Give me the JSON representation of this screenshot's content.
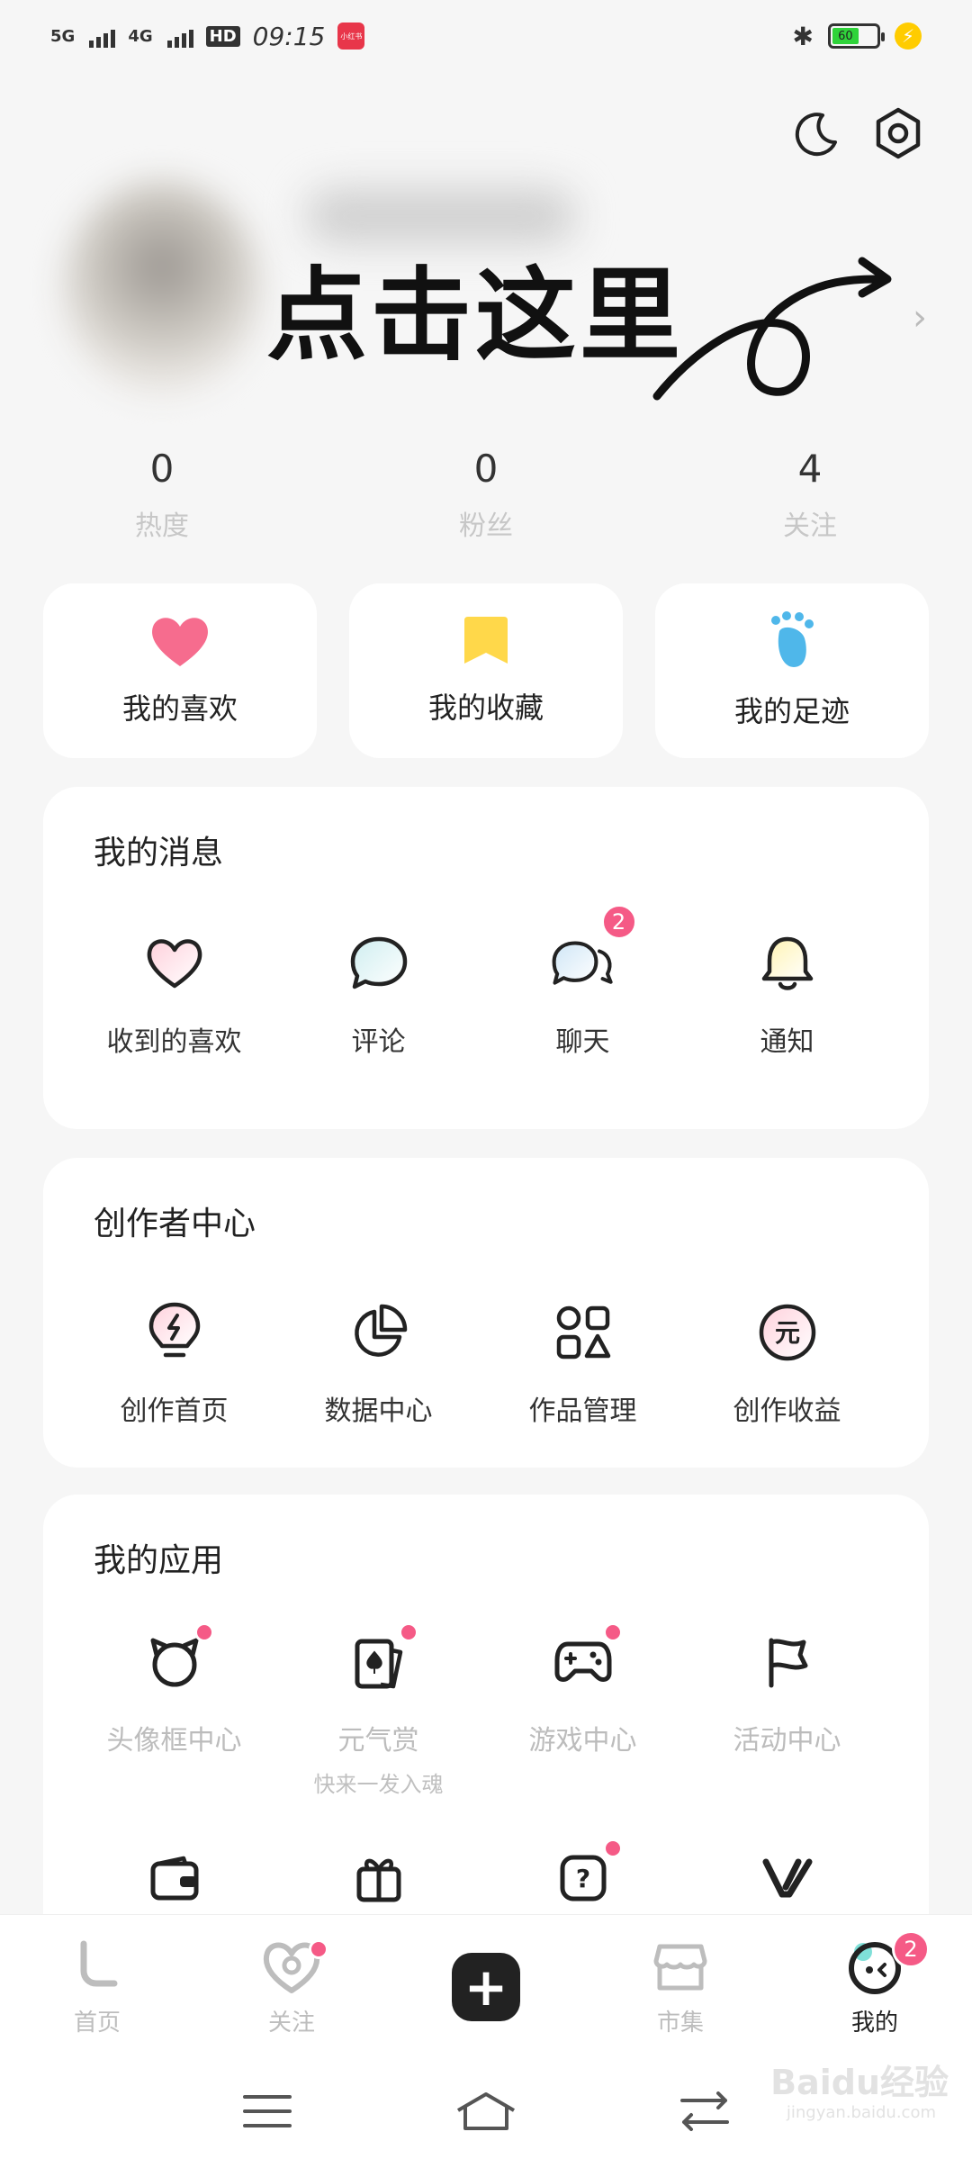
{
  "status_bar": {
    "net1": "5G",
    "net2": "4G",
    "hd": "HD",
    "time": "09:15",
    "app_badge": "小红书",
    "battery_level": "60"
  },
  "overlay_annotation": "点击这里",
  "stats": [
    {
      "value": "0",
      "label": "热度"
    },
    {
      "value": "0",
      "label": "粉丝"
    },
    {
      "value": "4",
      "label": "关注"
    }
  ],
  "quick_cards": [
    {
      "label": "我的喜欢",
      "icon": "heart-icon",
      "color": "#f66c8e"
    },
    {
      "label": "我的收藏",
      "icon": "bookmark-icon",
      "color": "#ffd84a"
    },
    {
      "label": "我的足迹",
      "icon": "footprint-icon",
      "color": "#4fb7ea"
    }
  ],
  "messages": {
    "title": "我的消息",
    "items": [
      {
        "label": "收到的喜欢",
        "icon": "heart-outline-icon"
      },
      {
        "label": "评论",
        "icon": "comment-icon"
      },
      {
        "label": "聊天",
        "icon": "chat-icon",
        "badge": "2"
      },
      {
        "label": "通知",
        "icon": "bell-icon"
      }
    ]
  },
  "creator": {
    "title": "创作者中心",
    "items": [
      {
        "label": "创作首页",
        "icon": "lightbulb-icon"
      },
      {
        "label": "数据中心",
        "icon": "pie-chart-icon"
      },
      {
        "label": "作品管理",
        "icon": "shapes-icon"
      },
      {
        "label": "创作收益",
        "icon": "yuan-coin-icon"
      }
    ]
  },
  "apps": {
    "title": "我的应用",
    "items": [
      {
        "label": "头像框中心",
        "icon": "avatar-frame-icon",
        "dot": true
      },
      {
        "label": "元气赏",
        "icon": "card-icon",
        "dot": true,
        "sub": "快来一发入魂"
      },
      {
        "label": "游戏中心",
        "icon": "gamepad-icon",
        "dot": true
      },
      {
        "label": "活动中心",
        "icon": "flag-icon",
        "dot": false
      }
    ],
    "row2": [
      {
        "icon": "wallet-icon",
        "dot": false
      },
      {
        "icon": "gift-icon",
        "dot": false
      },
      {
        "icon": "help-icon",
        "dot": true
      },
      {
        "icon": "v-logo-icon",
        "dot": false
      }
    ]
  },
  "bottom_nav": [
    {
      "label": "首页",
      "icon": "home-icon"
    },
    {
      "label": "关注",
      "icon": "follow-icon",
      "dot": true
    },
    {
      "label": "",
      "icon": "plus-icon"
    },
    {
      "label": "市集",
      "icon": "store-icon"
    },
    {
      "label": "我的",
      "icon": "me-icon",
      "badge": "2",
      "active": true
    }
  ],
  "watermark": {
    "text": "Baidu经验",
    "sub": "jingyan.baidu.com"
  },
  "colors": {
    "accent_pink": "#f55a86",
    "background": "#f6f6f6"
  }
}
